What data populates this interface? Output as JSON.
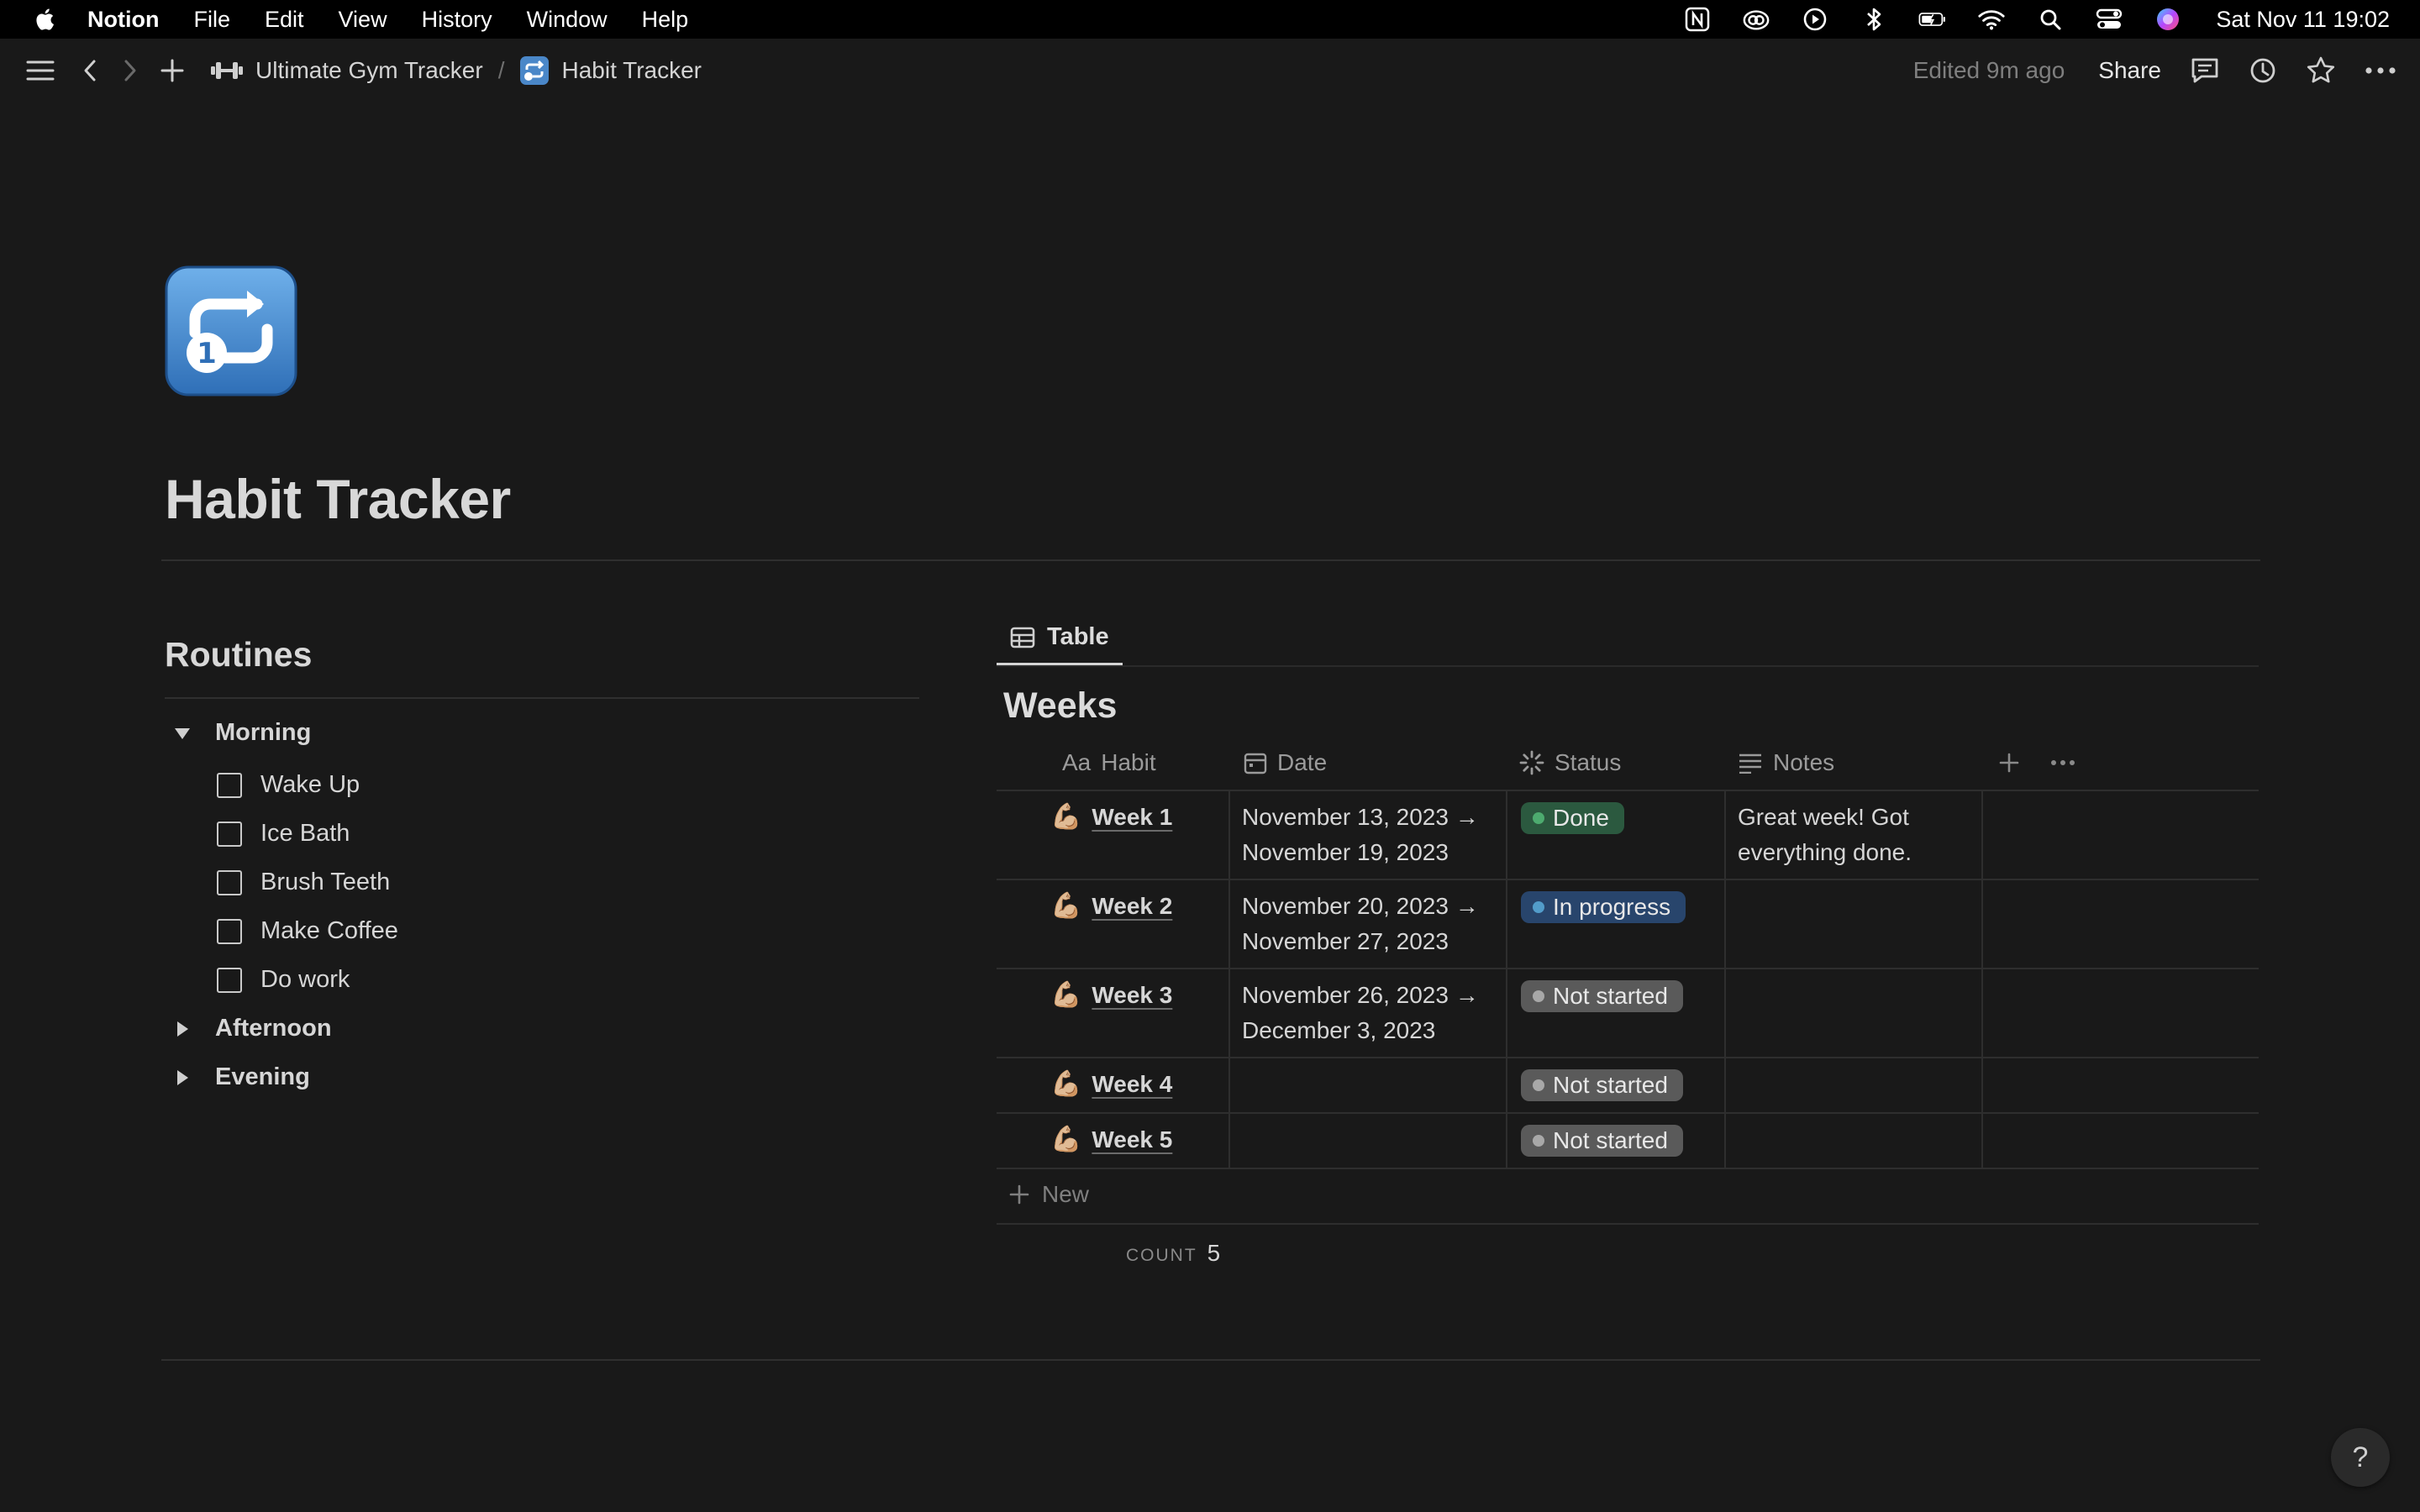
{
  "menubar": {
    "app_name": "Notion",
    "items": [
      "File",
      "Edit",
      "View",
      "History",
      "Window",
      "Help"
    ],
    "clock": "Sat Nov 11  19:02"
  },
  "topbar": {
    "breadcrumb_parent": "Ultimate Gym Tracker",
    "breadcrumb_separator": "/",
    "breadcrumb_current": "Habit Tracker",
    "edited": "Edited 9m ago",
    "share": "Share"
  },
  "page": {
    "title": "Habit Tracker",
    "icon": "repeat-one-emoji"
  },
  "routines": {
    "title": "Routines",
    "toggles": [
      {
        "label": "Morning",
        "expanded": true,
        "items": [
          "Wake Up",
          "Ice Bath",
          "Brush Teeth",
          "Make Coffee",
          "Do work"
        ]
      },
      {
        "label": "Afternoon",
        "expanded": false
      },
      {
        "label": "Evening",
        "expanded": false
      }
    ]
  },
  "database": {
    "view_tab": "Table",
    "title": "Weeks",
    "columns": {
      "habit": "Habit",
      "habit_prefix": "Aa",
      "date": "Date",
      "status": "Status",
      "notes": "Notes"
    },
    "rows": [
      {
        "emoji": "💪🏼",
        "name": "Week 1",
        "date_line1": "November 13, 2023 →",
        "date_line2": "November 19, 2023",
        "status": "Done",
        "notes_line1": "Great week! Got",
        "notes_line2": "everything done."
      },
      {
        "emoji": "💪🏼",
        "name": "Week 2",
        "date_line1": "November 20, 2023 →",
        "date_line2": "November 27, 2023",
        "status": "In progress",
        "notes_line1": "",
        "notes_line2": ""
      },
      {
        "emoji": "💪🏼",
        "name": "Week 3",
        "date_line1": "November 26, 2023 →",
        "date_line2": "December 3, 2023",
        "status": "Not started",
        "notes_line1": "",
        "notes_line2": ""
      },
      {
        "emoji": "💪🏼",
        "name": "Week 4",
        "date_line1": "",
        "date_line2": "",
        "status": "Not started",
        "notes_line1": "",
        "notes_line2": ""
      },
      {
        "emoji": "💪🏼",
        "name": "Week 5",
        "date_line1": "",
        "date_line2": "",
        "status": "Not started",
        "notes_line1": "",
        "notes_line2": ""
      }
    ],
    "new_label": "New",
    "count_label": "COUNT",
    "count_value": "5"
  },
  "status_colors": {
    "done_bg": "#2b593f",
    "done_dot": "#4dab6f",
    "in_progress_bg": "#28456c",
    "in_progress_dot": "#529cca",
    "not_started_bg": "#5a5a5a",
    "not_started_dot": "#a8a8a8"
  },
  "help": "?"
}
